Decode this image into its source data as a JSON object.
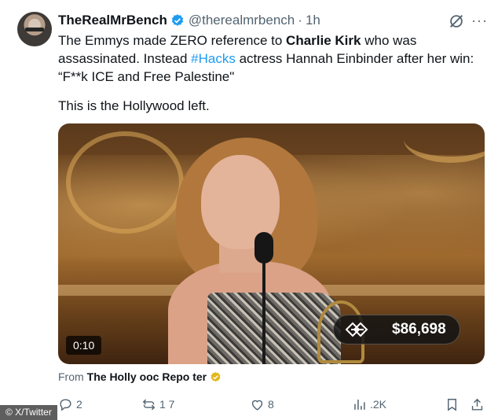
{
  "tweet": {
    "author_name": "TheRealMrBench",
    "handle": "@therealmrbench",
    "separator": "·",
    "time": "1h",
    "text_parts": [
      {
        "t": "The Emmys made ZERO reference to ",
        "style": "normal"
      },
      {
        "t": "Charlie Kirk",
        "style": "bold"
      },
      {
        "t": " who was assassinated. Instead ",
        "style": "normal"
      },
      {
        "t": "#Hacks",
        "style": "hashtag"
      },
      {
        "t": " actress Hannah Einbinder after her win: “F**k ICE and Free Palestine\"",
        "style": "normal"
      }
    ],
    "text_para2": "This is the Hollywood left."
  },
  "media": {
    "duration": "0:10",
    "ad_price": "$86,698"
  },
  "source": {
    "prefix": "From",
    "name": "The Holly  ooc Repo  ter"
  },
  "actions": {
    "replies": "2",
    "reposts": "1 7",
    "likes": "8",
    "views": ".2K"
  },
  "watermark": "© X/Twitter",
  "colors": {
    "link": "#1d9bf0",
    "secondary_text": "#536471",
    "verified": "#1d9bf0",
    "gold_badge": "#e2b719"
  },
  "icons": [
    "grok-icon",
    "more-icon",
    "verified-icon",
    "reply-icon",
    "repost-icon",
    "like-icon",
    "views-icon",
    "bookmark-icon",
    "share-icon"
  ]
}
